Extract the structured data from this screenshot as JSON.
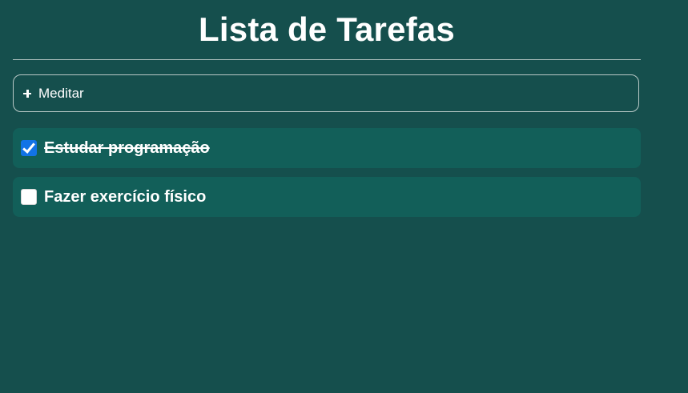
{
  "header": {
    "title": "Lista de Tarefas"
  },
  "add_task": {
    "placeholder": "Meditar",
    "value": "Meditar",
    "icon": "plus-icon"
  },
  "tasks": [
    {
      "label": "Estudar programação",
      "completed": true
    },
    {
      "label": "Fazer exercício físico",
      "completed": false
    }
  ],
  "colors": {
    "background": "#154f4d",
    "task_background": "#125f59",
    "checkbox_checked": "#1273e6",
    "text": "#ffffff"
  }
}
